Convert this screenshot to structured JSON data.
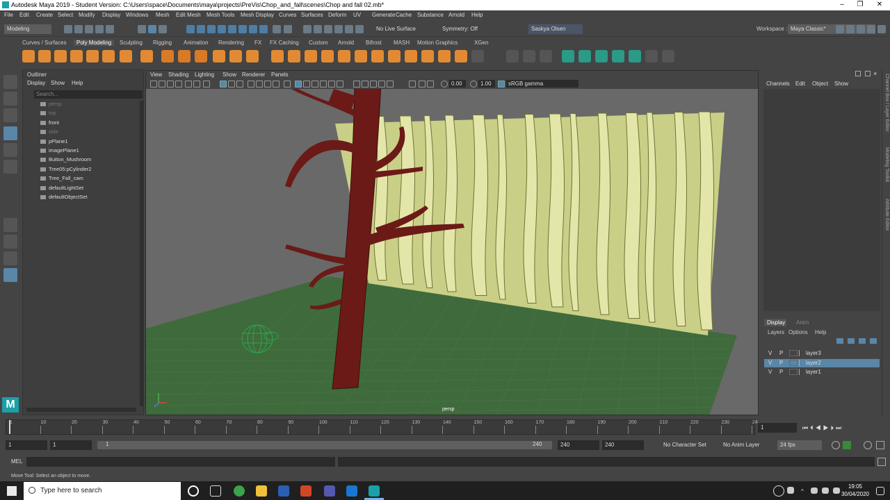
{
  "titlebar": {
    "title": "Autodesk Maya 2019 - Student Version: C:\\Users\\space\\Documents\\maya\\projects\\PreVis\\Chop_and_fall\\scenes\\Chop and fall 02.mb*"
  },
  "menubar": {
    "items": [
      "File",
      "Edit",
      "Create",
      "Select",
      "Modify",
      "Display",
      "Windows",
      "Mesh",
      "Edit Mesh",
      "Mesh Tools",
      "Mesh Display",
      "Curves",
      "Surfaces",
      "Deform",
      "UV",
      "Generate",
      "Cache",
      "Substance",
      "Arnold",
      "Help"
    ]
  },
  "statusline": {
    "mode": "Modeling",
    "live_surface": "No Live Surface",
    "symmetry": "Symmetry: Off",
    "user": "Saskya Olsen",
    "workspace_label": "Workspace :",
    "workspace": "Maya Classic*"
  },
  "shelf": {
    "tabs": [
      "Curves / Surfaces",
      "Poly Modeling",
      "Sculpting",
      "Rigging",
      "Animation",
      "Rendering",
      "FX",
      "FX Caching",
      "Custom",
      "Arnold",
      "Bifrost",
      "MASH",
      "Motion Graphics",
      "XGen"
    ],
    "active": "Poly Modeling"
  },
  "outliner": {
    "title": "Outliner",
    "menu": [
      "Display",
      "Show",
      "Help"
    ],
    "search_placeholder": "Search...",
    "items": [
      {
        "label": "persp",
        "dim": true
      },
      {
        "label": "top",
        "dim": true
      },
      {
        "label": "front",
        "dim": false
      },
      {
        "label": "side",
        "dim": true
      },
      {
        "label": "pPlane1",
        "dim": false
      },
      {
        "label": "imagePlane1",
        "dim": false
      },
      {
        "label": "Button_Mushroom",
        "dim": false
      },
      {
        "label": "Tree05:pCylinder2",
        "dim": false
      },
      {
        "label": "Tree_Fall_cam",
        "dim": false
      },
      {
        "label": "defaultLightSet",
        "dim": false
      },
      {
        "label": "defaultObjectSet",
        "dim": false
      }
    ]
  },
  "viewport": {
    "menu": [
      "View",
      "Shading",
      "Lighting",
      "Show",
      "Renderer",
      "Panels"
    ],
    "near": "0.00",
    "far": "1.00",
    "color_space": "sRGB gamma",
    "camera_label": "persp",
    "colors": {
      "ground": "#3f6a3c",
      "trunk": "#6b1a17",
      "backdrop": "#c9cf86",
      "bg": "#696969"
    }
  },
  "channelbox": {
    "menu": [
      "Channels",
      "Edit",
      "Object",
      "Show"
    ],
    "side_tabs": [
      "Channel Box / Layer Editor",
      "Modeling Toolkit",
      "Attribute Editor"
    ]
  },
  "layers": {
    "tabs": [
      "Display",
      "Anim"
    ],
    "menu": [
      "Layers",
      "Options",
      "Help"
    ],
    "rows": [
      {
        "v": "V",
        "p": "P",
        "name": "layer3",
        "selected": false
      },
      {
        "v": "V",
        "p": "P",
        "name": "layer2",
        "selected": true
      },
      {
        "v": "V",
        "p": "P",
        "name": "layer1",
        "selected": false
      }
    ]
  },
  "timeline": {
    "ticks": [
      "1",
      "10",
      "20",
      "30",
      "40",
      "50",
      "60",
      "70",
      "80",
      "90",
      "100",
      "110",
      "120",
      "130",
      "140",
      "150",
      "160",
      "170",
      "180",
      "190",
      "200",
      "210",
      "220",
      "230",
      "24"
    ],
    "current_frame": "1"
  },
  "range": {
    "start": "1",
    "start2": "1",
    "slider_start": "1",
    "slider_end": "240",
    "end": "240",
    "end2": "240",
    "character_set": "No Character Set",
    "anim_layer": "No Anim Layer",
    "fps": "24 fps"
  },
  "mel": {
    "label": "MEL"
  },
  "helpline": {
    "text": "Move Tool: Select an object to move."
  },
  "taskbar": {
    "search": "Type here to search",
    "time": "19:05",
    "date": "30/04/2020"
  }
}
